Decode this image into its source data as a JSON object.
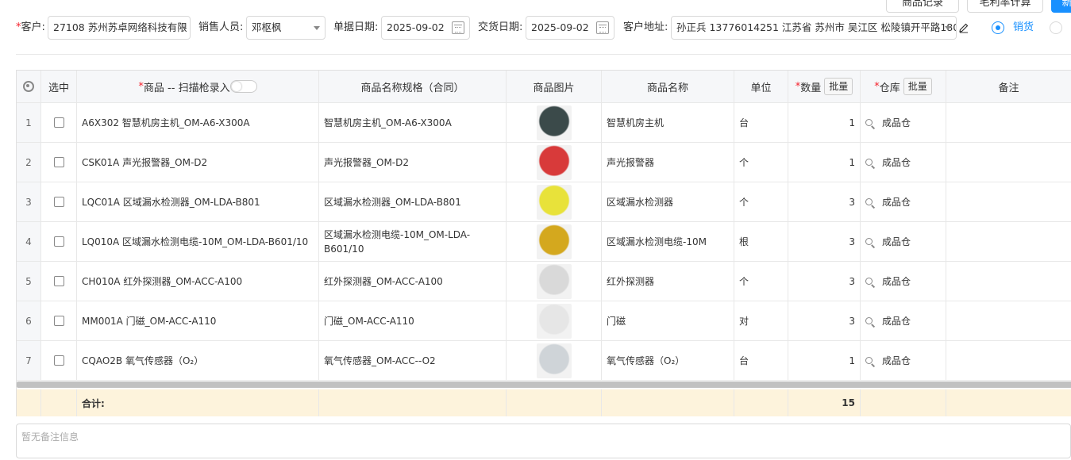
{
  "header_buttons": {
    "product_records": "商品记录",
    "margin_calc": "毛利率计算",
    "third": "新"
  },
  "form": {
    "customer_label": "客户:",
    "customer_value": "27108 苏州苏卓网络科技有限",
    "salesperson_label": "销售人员:",
    "salesperson_value": "邓枢枫",
    "doc_date_label": "单据日期:",
    "doc_date_value": "2025-09-02",
    "delivery_date_label": "交货日期:",
    "delivery_date_value": "2025-09-02",
    "address_label": "客户地址:",
    "address_value": "孙正兵 13776014251 江苏省 苏州市 吴江区 松陵镇开平路180",
    "radio_sales_label": "销货"
  },
  "table": {
    "headers": {
      "select": "选中",
      "product": "商品 -- 扫描枪录入",
      "spec": "商品名称规格（合同）",
      "image": "商品图片",
      "name": "商品名称",
      "unit": "单位",
      "qty": "数量",
      "qty_batch": "批量",
      "warehouse": "仓库",
      "wh_batch": "批量",
      "remark": "备注"
    },
    "rows": [
      {
        "idx": "1",
        "product": "A6X302 智慧机房主机_OM-A6-X300A",
        "spec": "智慧机房主机_OM-A6-X300A",
        "name": "智慧机房主机",
        "unit": "台",
        "qty": "1",
        "warehouse": "成品仓",
        "img_color": "#3b4a4a"
      },
      {
        "idx": "2",
        "product": "CSK01A 声光报警器_OM-D2",
        "spec": "声光报警器_OM-D2",
        "name": "声光报警器",
        "unit": "个",
        "qty": "1",
        "warehouse": "成品仓",
        "img_color": "#d83a3a"
      },
      {
        "idx": "3",
        "product": "LQC01A 区域漏水检测器_OM-LDA-B801",
        "spec": "区域漏水检测器_OM-LDA-B801",
        "name": "区域漏水检测器",
        "unit": "个",
        "qty": "3",
        "warehouse": "成品仓",
        "img_color": "#e8e23a"
      },
      {
        "idx": "4",
        "product": "LQ010A 区域漏水检测电缆-10M_OM-LDA-B601/10",
        "spec": "区域漏水检测电缆-10M_OM-LDA-B601/10",
        "name": "区域漏水检测电缆-10M",
        "unit": "根",
        "qty": "3",
        "warehouse": "成品仓",
        "img_color": "#d4a81e"
      },
      {
        "idx": "5",
        "product": "CH010A 红外探测器_OM-ACC-A100",
        "spec": "红外探测器_OM-ACC-A100",
        "name": "红外探测器",
        "unit": "个",
        "qty": "3",
        "warehouse": "成品仓",
        "img_color": "#d9d9d9"
      },
      {
        "idx": "6",
        "product": "MM001A 门磁_OM-ACC-A110",
        "spec": "门磁_OM-ACC-A110",
        "name": "门磁",
        "unit": "对",
        "qty": "3",
        "warehouse": "成品仓",
        "img_color": "#e6e6e6"
      },
      {
        "idx": "7",
        "product": "CQAO2B 氧气传感器（O₂）",
        "spec": "氧气传感器_OM-ACC--O2",
        "name": "氧气传感器（O₂）",
        "unit": "台",
        "qty": "1",
        "warehouse": "成品仓",
        "img_color": "#cfd4d8"
      }
    ],
    "total_label": "合计:",
    "total_qty": "15"
  },
  "remark_placeholder": "暂无备注信息"
}
